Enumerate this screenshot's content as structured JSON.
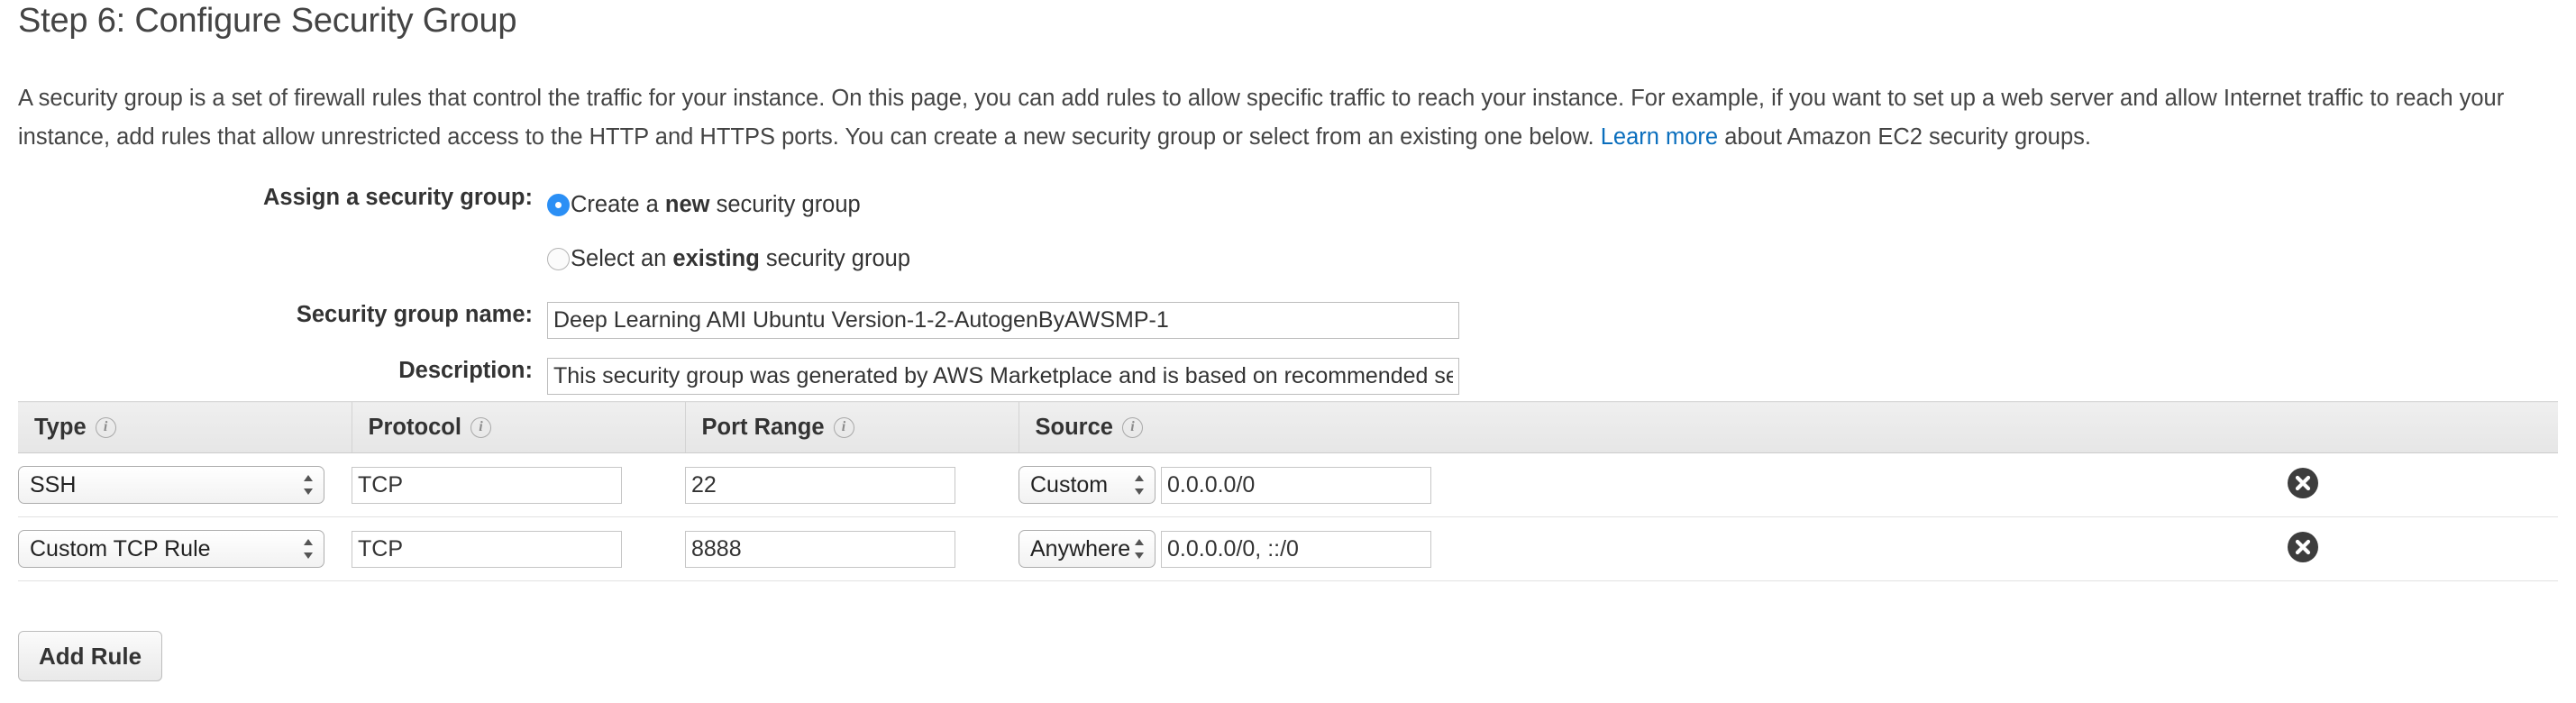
{
  "heading": "Step 6: Configure Security Group",
  "intro": {
    "part1": "A security group is a set of firewall rules that control the traffic for your instance. On this page, you can add rules to allow specific traffic to reach your instance. For example, if you want to set up a web server and allow Internet traffic to reach your instance, add rules that allow unrestricted access to the HTTP and HTTPS ports. You can create a new security group or select from an existing one below. ",
    "link": "Learn more",
    "part2": " about Amazon EC2 security groups.",
    "link_color": "#0a6ebd"
  },
  "assign": {
    "label": "Assign a security group:",
    "options": [
      {
        "prefix": "Create a ",
        "strong": "new",
        "suffix": " security group",
        "selected": true
      },
      {
        "prefix": "Select an ",
        "strong": "existing",
        "suffix": " security group",
        "selected": false
      }
    ],
    "selected_color": "#2b8ff5"
  },
  "fields": {
    "sg_name_label": "Security group name:",
    "sg_name_value": "Deep Learning AMI Ubuntu Version-1-2-AutogenByAWSMP-1",
    "description_label": "Description:",
    "description_value": "This security group was generated by AWS Marketplace and is based on recommended settings for Deep Learning AMI Ubuntu Version version 1.2 provided by Amazon Web Services"
  },
  "table": {
    "headers": [
      {
        "label": "Type",
        "info": "info-icon"
      },
      {
        "label": "Protocol",
        "info": "info-icon"
      },
      {
        "label": "Port Range",
        "info": "info-icon"
      },
      {
        "label": "Source",
        "info": "info-icon"
      }
    ],
    "rows": [
      {
        "type": "SSH",
        "protocol": "TCP",
        "port_range": "22",
        "source_kind": "Custom",
        "source_value": "0.0.0.0/0",
        "delete": "delete-rule"
      },
      {
        "type": "Custom TCP Rule",
        "protocol": "TCP",
        "port_range": "8888",
        "source_kind": "Anywhere",
        "source_value": "0.0.0.0/0, ::/0",
        "delete": "delete-rule"
      }
    ]
  },
  "add_rule_label": "Add Rule"
}
